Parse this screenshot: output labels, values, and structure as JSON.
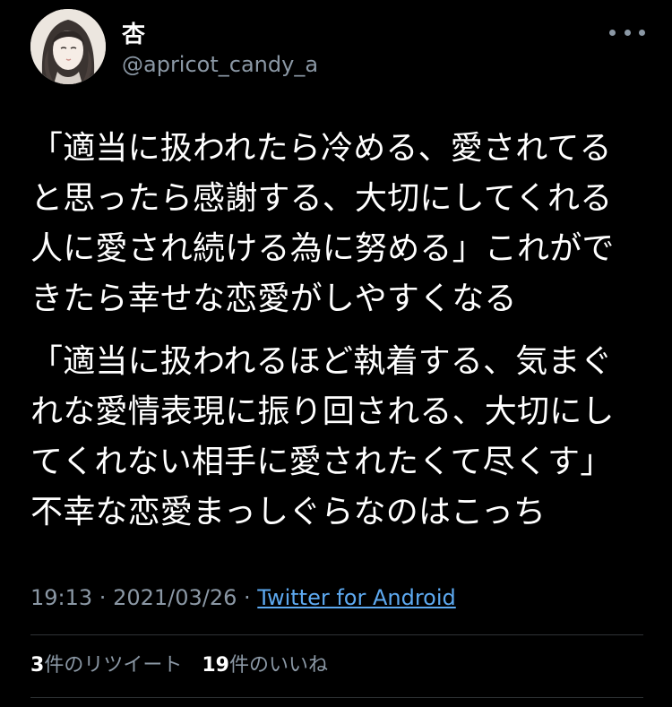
{
  "user": {
    "display_name": "杏",
    "handle": "@apricot_candy_a"
  },
  "tweet": {
    "paragraphs": [
      {
        "lines": [
          "「適当に扱われたら冷める、愛されてる",
          "と思ったら感謝する、大切にしてくれる",
          "人に愛され続ける為に努める」これがで",
          "きたら幸せな恋愛がしやすくなる"
        ]
      },
      {
        "lines": [
          "「適当に扱われるほど執着する、気まぐ",
          "れな愛情表現に振り回される、大切にし",
          "てくれない相手に愛されたくて尽くす」",
          "不幸な恋愛まっしぐらなのはこっち"
        ]
      }
    ],
    "time": "19:13",
    "separator": " · ",
    "date": "2021/03/26",
    "source": "Twitter for Android"
  },
  "stats": {
    "retweets_count": "3",
    "retweets_label": "件のリツイート",
    "likes_count": "19",
    "likes_label": "件のいいね"
  },
  "icons": {
    "more": "more-horizontal-icon"
  },
  "colors": {
    "background": "#000000",
    "text": "#ffffff",
    "secondary": "#8b98a5",
    "link": "#5da9f0",
    "divider": "#2f3336"
  }
}
